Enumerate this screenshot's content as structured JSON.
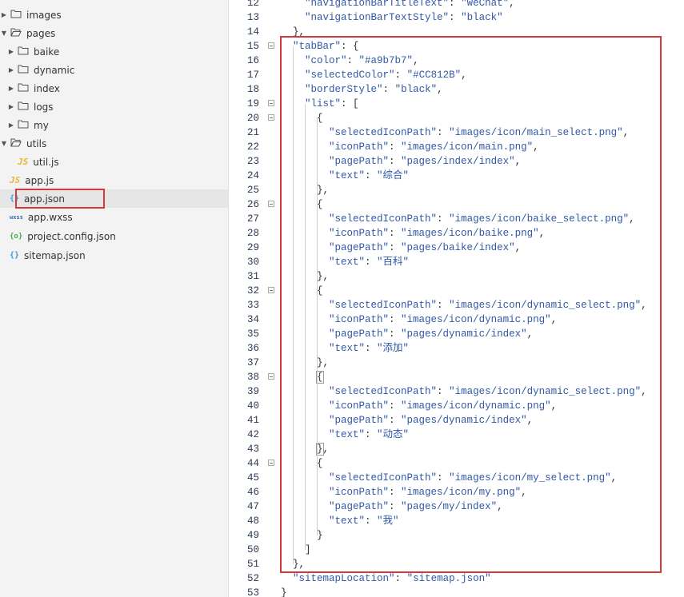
{
  "tree": [
    {
      "label": "images",
      "type": "folder",
      "state": "collapsed"
    },
    {
      "label": "pages",
      "type": "folder",
      "state": "expanded"
    },
    {
      "label": "baike",
      "type": "folder",
      "state": "collapsed"
    },
    {
      "label": "dynamic",
      "type": "folder",
      "state": "collapsed"
    },
    {
      "label": "index",
      "type": "folder",
      "state": "collapsed"
    },
    {
      "label": "logs",
      "type": "folder",
      "state": "collapsed"
    },
    {
      "label": "my",
      "type": "folder",
      "state": "collapsed"
    },
    {
      "label": "utils",
      "type": "folder",
      "state": "expanded"
    },
    {
      "label": "util.js",
      "type": "js"
    },
    {
      "label": "app.js",
      "type": "js"
    },
    {
      "label": "app.json",
      "type": "json",
      "selected": true
    },
    {
      "label": "app.wxss",
      "type": "wxss"
    },
    {
      "label": "project.config.json",
      "type": "config"
    },
    {
      "label": "sitemap.json",
      "type": "json"
    }
  ],
  "icons": {
    "js": "JS",
    "json": "{}",
    "config": "{o}",
    "wxss": "wxss"
  },
  "colors": {
    "highlight_border": "#d6393c",
    "string": "#3058a8",
    "selected_row": "#e6e6e6"
  },
  "editor": {
    "lines": [
      {
        "n": "12",
        "text": "    \"navigationBarTitleText\": \"WeChat\","
      },
      {
        "n": "13",
        "text": "    \"navigationBarTextStyle\": \"black\""
      },
      {
        "n": "14",
        "text": "  },"
      },
      {
        "n": "15",
        "text": "  \"tabBar\": {",
        "fold": true
      },
      {
        "n": "16",
        "text": "    \"color\": \"#a9b7b7\","
      },
      {
        "n": "17",
        "text": "    \"selectedColor\": \"#CC812B\","
      },
      {
        "n": "18",
        "text": "    \"borderStyle\": \"black\","
      },
      {
        "n": "19",
        "text": "    \"list\": [",
        "fold": true
      },
      {
        "n": "20",
        "text": "      {",
        "fold": true
      },
      {
        "n": "21",
        "text": "        \"selectedIconPath\": \"images/icon/main_select.png\","
      },
      {
        "n": "22",
        "text": "        \"iconPath\": \"images/icon/main.png\","
      },
      {
        "n": "23",
        "text": "        \"pagePath\": \"pages/index/index\","
      },
      {
        "n": "24",
        "text": "        \"text\": \"综合\""
      },
      {
        "n": "25",
        "text": "      },"
      },
      {
        "n": "26",
        "text": "      {",
        "fold": true
      },
      {
        "n": "27",
        "text": "        \"selectedIconPath\": \"images/icon/baike_select.png\","
      },
      {
        "n": "28",
        "text": "        \"iconPath\": \"images/icon/baike.png\","
      },
      {
        "n": "29",
        "text": "        \"pagePath\": \"pages/baike/index\","
      },
      {
        "n": "30",
        "text": "        \"text\": \"百科\""
      },
      {
        "n": "31",
        "text": "      },"
      },
      {
        "n": "32",
        "text": "      {",
        "fold": true
      },
      {
        "n": "33",
        "text": "        \"selectedIconPath\": \"images/icon/dynamic_select.png\","
      },
      {
        "n": "34",
        "text": "        \"iconPath\": \"images/icon/dynamic.png\","
      },
      {
        "n": "35",
        "text": "        \"pagePath\": \"pages/dynamic/index\","
      },
      {
        "n": "36",
        "text": "        \"text\": \"添加\""
      },
      {
        "n": "37",
        "text": "      },"
      },
      {
        "n": "38",
        "text": "      {",
        "fold": true,
        "hl": true
      },
      {
        "n": "39",
        "text": "        \"selectedIconPath\": \"images/icon/dynamic_select.png\","
      },
      {
        "n": "40",
        "text": "        \"iconPath\": \"images/icon/dynamic.png\","
      },
      {
        "n": "41",
        "text": "        \"pagePath\": \"pages/dynamic/index\","
      },
      {
        "n": "42",
        "text": "        \"text\": \"动态\""
      },
      {
        "n": "43",
        "text": "      },",
        "hl": true
      },
      {
        "n": "44",
        "text": "      {",
        "fold": true
      },
      {
        "n": "45",
        "text": "        \"selectedIconPath\": \"images/icon/my_select.png\","
      },
      {
        "n": "46",
        "text": "        \"iconPath\": \"images/icon/my.png\","
      },
      {
        "n": "47",
        "text": "        \"pagePath\": \"pages/my/index\","
      },
      {
        "n": "48",
        "text": "        \"text\": \"我\""
      },
      {
        "n": "49",
        "text": "      }"
      },
      {
        "n": "50",
        "text": "    ]"
      },
      {
        "n": "51",
        "text": "  },"
      },
      {
        "n": "52",
        "text": "  \"sitemapLocation\": \"sitemap.json\""
      },
      {
        "n": "53",
        "text": "}"
      }
    ]
  }
}
